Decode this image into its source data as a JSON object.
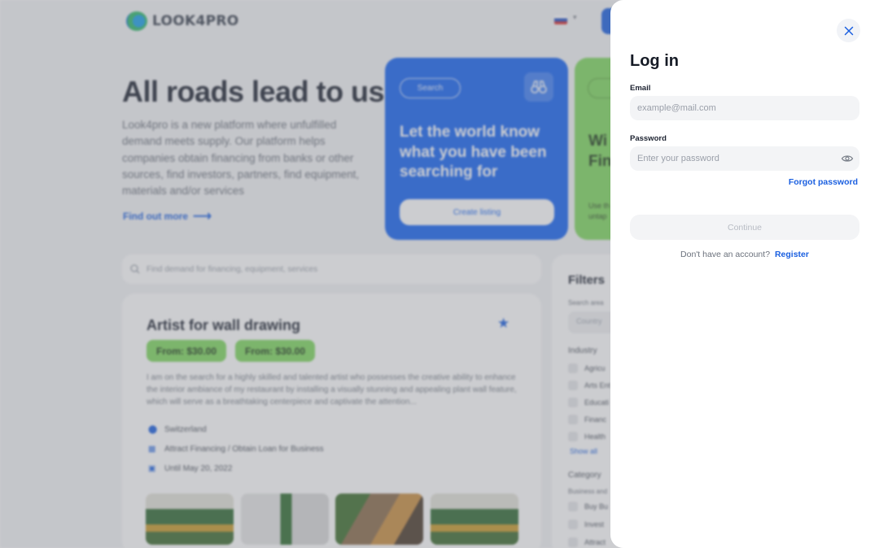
{
  "background": {
    "logo_text": "LOOK4PRO",
    "hero": {
      "title": "All roads lead to us",
      "description": "Look4pro is a new platform where unfulfilled demand meets supply. Our platform helps companies obtain financing from banks or other sources, find investors, partners, find equipment, materials and/or services",
      "find_more": "Find out more"
    },
    "blue_card": {
      "tag": "Search",
      "heading": "Let the world know what you have been searching for",
      "button": "Create listing"
    },
    "green_card": {
      "heading_line1": "Wi",
      "heading_line2": "Fin",
      "sub_line1": "Use th",
      "sub_line2": "untap"
    },
    "search_placeholder": "Find demand for financing, equipment, services",
    "listing": {
      "title": "Artist for wall drawing",
      "prices": [
        "From: $30.00",
        "From: $30.00"
      ],
      "description": "I am on the search for a highly skilled and talented artist who possesses the creative ability to enhance the interior ambiance of my restaurant by installing a visually stunning and appealing plant wall feature, which will serve as a breathtaking centerpiece and captivate the attention...",
      "location": "Switzerland",
      "category": "Attract Financing / Obtain Loan for Business",
      "deadline": "Until May 20, 2022"
    },
    "filters": {
      "title": "Filters",
      "search_area_label": "Search area",
      "country_placeholder": "Country",
      "industry_label": "Industry",
      "industry_options": [
        "Agricu",
        "Arts Ent",
        "Educati",
        "Financ",
        "Health"
      ],
      "show_all": "Show all",
      "category_label": "Category",
      "business_label": "Business and",
      "category_options": [
        "Buy Bu",
        "Invest",
        "Attract"
      ]
    }
  },
  "login": {
    "title": "Log in",
    "email_label": "Email",
    "email_placeholder": "example@mail.com",
    "password_label": "Password",
    "password_placeholder": "Enter your password",
    "forgot_password": "Forgot password",
    "continue_label": "Continue",
    "no_account_text": "Don't have an account?",
    "register_label": "Register"
  },
  "colors": {
    "accent": "#1a5fe0",
    "green": "#7fd85e"
  }
}
